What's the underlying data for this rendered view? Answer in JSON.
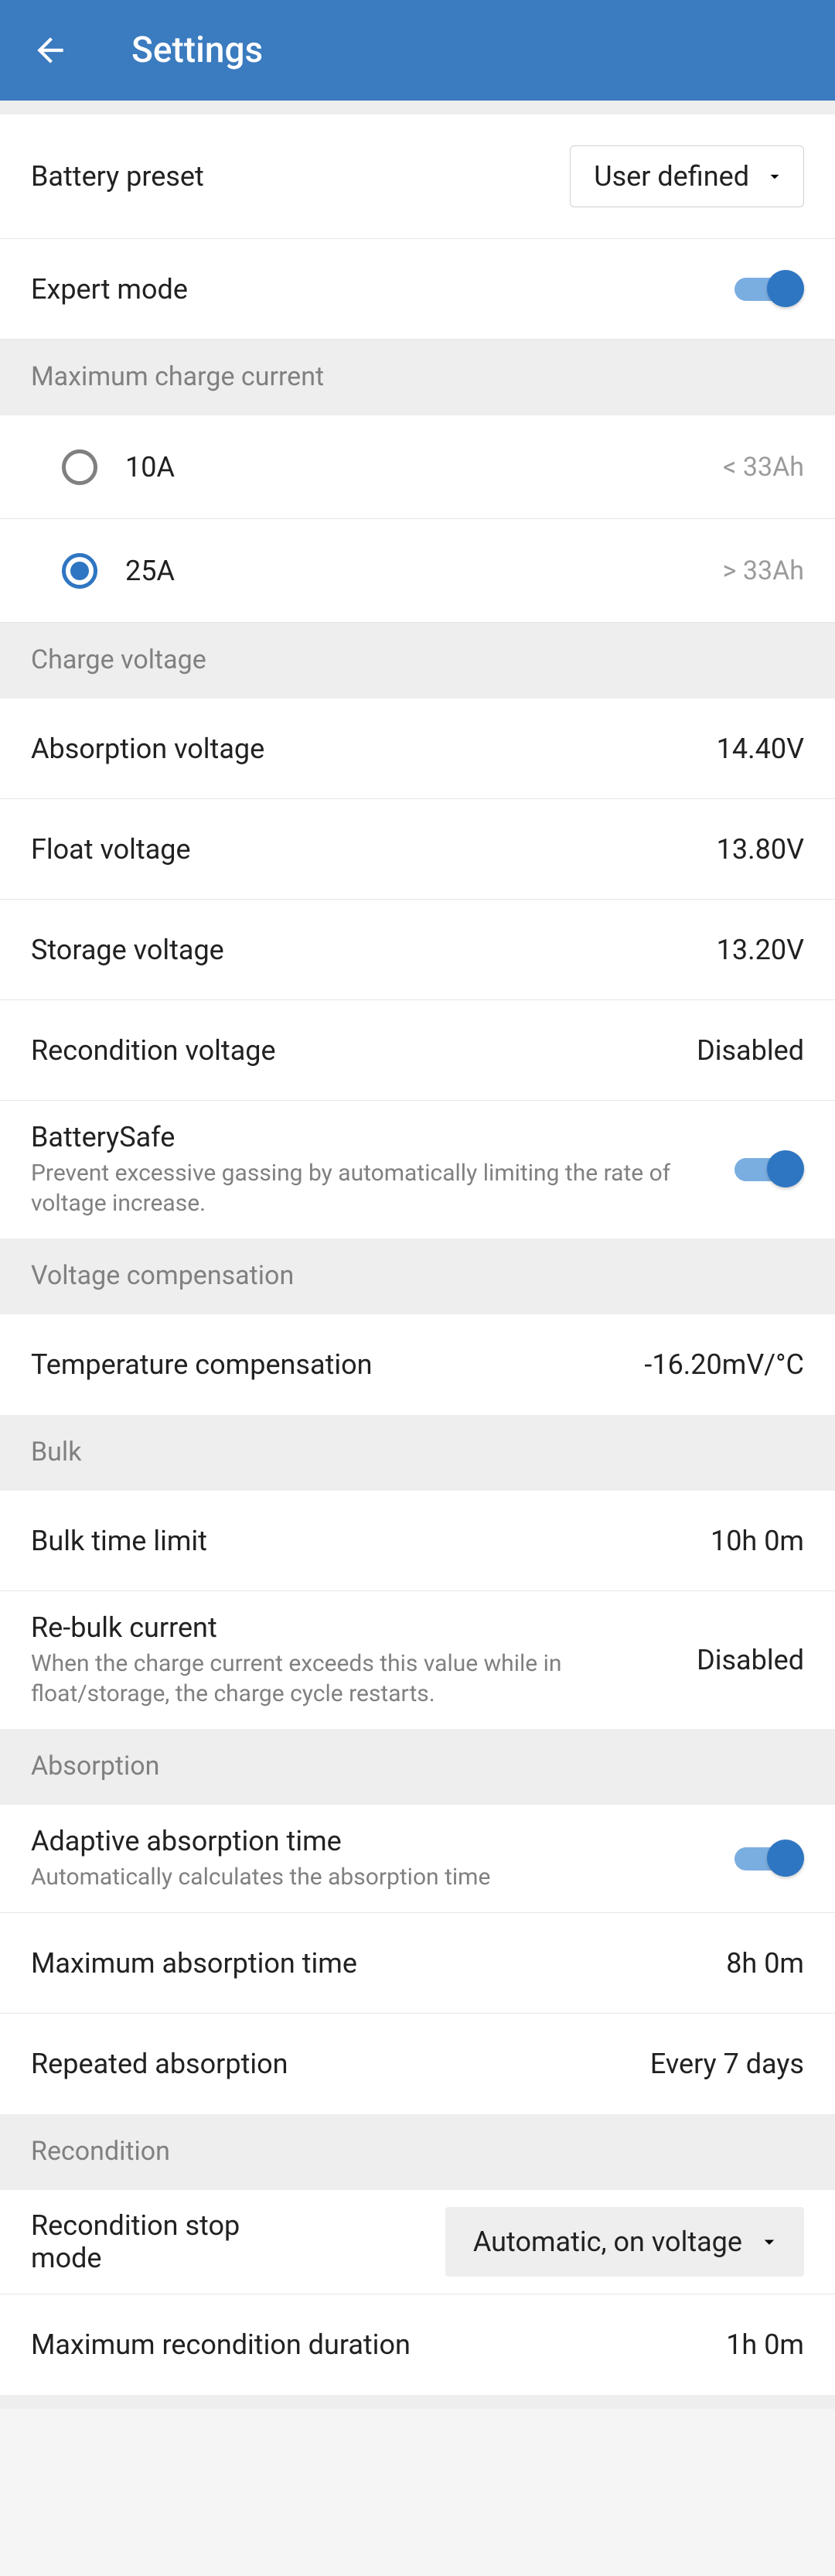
{
  "header": {
    "title": "Settings"
  },
  "preset": {
    "label": "Battery preset",
    "value": "User defined"
  },
  "expert": {
    "label": "Expert mode"
  },
  "maxCurrent": {
    "header": "Maximum charge current",
    "options": [
      {
        "label": "10A",
        "hint": "< 33Ah",
        "checked": false
      },
      {
        "label": "25A",
        "hint": "> 33Ah",
        "checked": true
      }
    ]
  },
  "chargeVoltage": {
    "header": "Charge voltage",
    "absorption": {
      "label": "Absorption voltage",
      "value": "14.40V"
    },
    "float": {
      "label": "Float voltage",
      "value": "13.80V"
    },
    "storage": {
      "label": "Storage voltage",
      "value": "13.20V"
    },
    "recondition": {
      "label": "Recondition voltage",
      "value": "Disabled"
    },
    "batterysafe": {
      "label": "BatterySafe",
      "sub": "Prevent excessive gassing by automatically limiting the rate of voltage increase."
    }
  },
  "voltageComp": {
    "header": "Voltage compensation",
    "temp": {
      "label": "Temperature compensation",
      "value": "-16.20mV/°C"
    }
  },
  "bulk": {
    "header": "Bulk",
    "limit": {
      "label": "Bulk time limit",
      "value": "10h 0m"
    },
    "rebulk": {
      "label": "Re-bulk current",
      "sub": "When the charge current exceeds this value while in float/storage, the charge cycle restarts.",
      "value": "Disabled"
    }
  },
  "absorption": {
    "header": "Absorption",
    "adaptive": {
      "label": "Adaptive absorption time",
      "sub": "Automatically calculates the absorption time"
    },
    "max": {
      "label": "Maximum absorption time",
      "value": "8h 0m"
    },
    "repeated": {
      "label": "Repeated absorption",
      "value": "Every 7 days"
    }
  },
  "recondition": {
    "header": "Recondition",
    "stopMode": {
      "label": "Recondition stop mode",
      "value": "Automatic, on voltage"
    },
    "maxDuration": {
      "label": "Maximum recondition duration",
      "value": "1h 0m"
    }
  }
}
